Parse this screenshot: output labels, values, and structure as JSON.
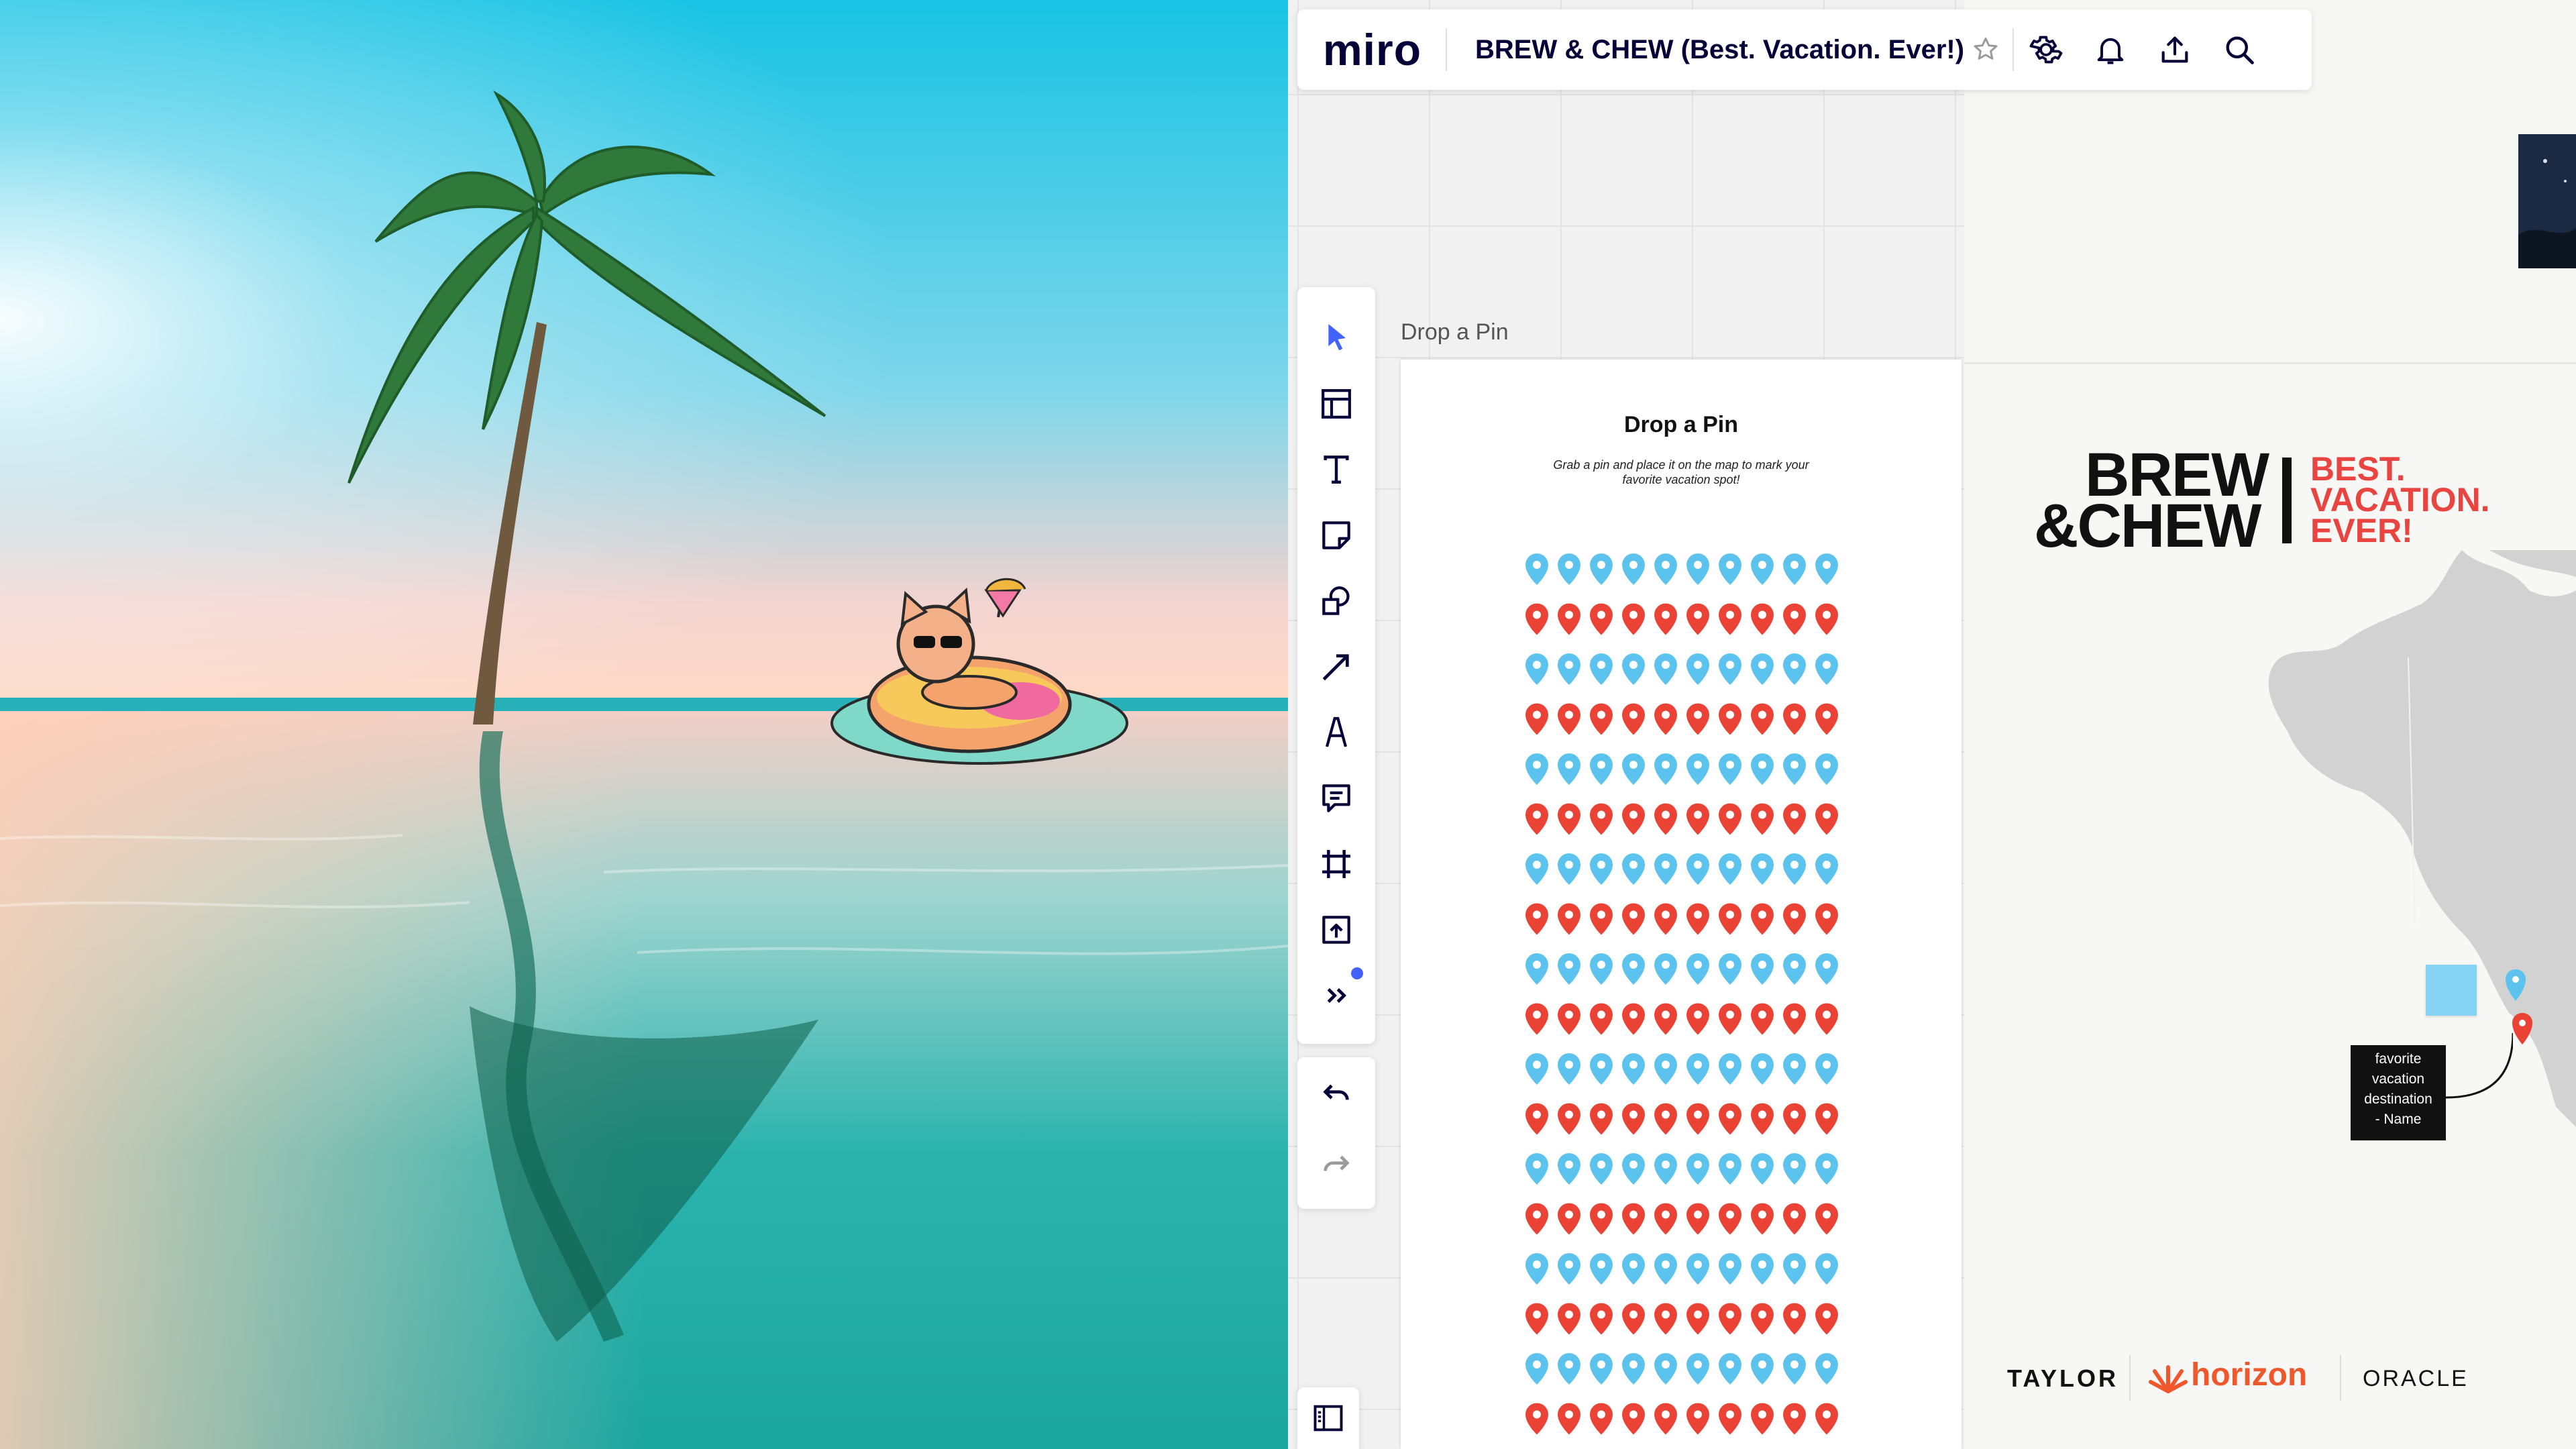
{
  "topbar": {
    "logo": "miro",
    "board_title": "BREW & CHEW (Best. Vacation. Ever!)"
  },
  "toolbar": {
    "tools": [
      "select-icon",
      "templates-icon",
      "text-icon",
      "sticky-note-icon",
      "shapes-icon",
      "connection-line-icon",
      "pen-icon",
      "comment-icon",
      "frame-icon",
      "upload-icon",
      "more-tools-icon"
    ]
  },
  "frame": {
    "label": "Drop a Pin",
    "title": "Drop a Pin",
    "subtitle": "Grab a pin and place it on the map to mark your favorite vacation spot!",
    "pin_rows": [
      "blue",
      "red",
      "blue",
      "red",
      "blue",
      "red",
      "blue",
      "red",
      "blue",
      "red",
      "blue",
      "red",
      "blue",
      "red",
      "blue",
      "red",
      "blue",
      "red"
    ],
    "pins_per_row": 10
  },
  "brand": {
    "line1": "BREW",
    "line2": "&CHEW",
    "tagline": [
      "BEST.",
      "VACATION.",
      "EVER!"
    ]
  },
  "note_card": {
    "lines": [
      "favorite",
      "vacation",
      "destination",
      "- Name"
    ]
  },
  "sponsors": {
    "taylor": "TAYLOR",
    "horizon": "horizon",
    "oracle": "ORACLE"
  },
  "colors": {
    "pin_blue": "#5bc3ee",
    "pin_red": "#ea4335",
    "accent": "#4262ff",
    "brand_red": "#e94440",
    "miro_navy": "#050038"
  }
}
